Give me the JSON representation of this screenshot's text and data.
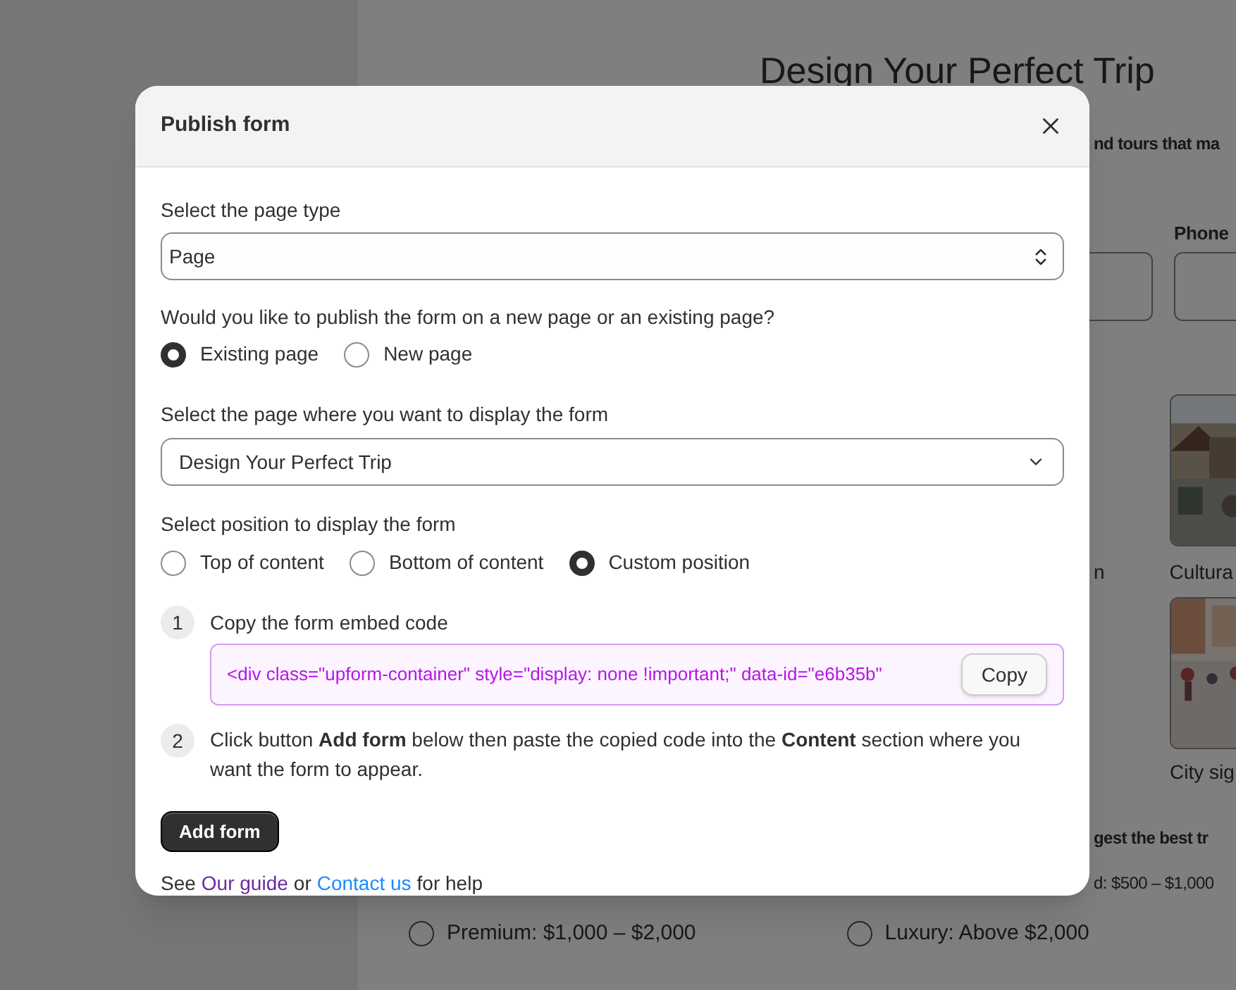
{
  "background_page": {
    "title": "Design Your Perfect Trip",
    "subtitle_fragment": "nd tours that ma",
    "phone_label": "Phone",
    "captions": [
      "n",
      "Cultura"
    ],
    "caption_2": "City sig",
    "question_fragment": "gest the best tr",
    "option_fragment": "d: $500 – $1,000",
    "budget_options": [
      {
        "label": "Premium: $1,000 – $2,000",
        "selected": false
      },
      {
        "label": "Luxury: Above $2,000",
        "selected": false
      }
    ]
  },
  "dialog": {
    "title": "Publish form",
    "page_type": {
      "label": "Select the page type",
      "value": "Page"
    },
    "publish_question": "Would you like to publish the form on a new page or an existing page?",
    "publish_options": [
      {
        "label": "Existing page",
        "selected": true
      },
      {
        "label": "New page",
        "selected": false
      }
    ],
    "target_page": {
      "label": "Select the page where you want to display the form",
      "value": "Design Your Perfect Trip"
    },
    "position_label": "Select position to display the form",
    "position_options": [
      {
        "label": "Top of content",
        "selected": false
      },
      {
        "label": "Bottom of content",
        "selected": false
      },
      {
        "label": "Custom position",
        "selected": true
      }
    ],
    "steps": [
      {
        "number": "1",
        "text": "Copy the form embed code"
      },
      {
        "number": "2",
        "text": "Click button **Add form** below then paste the copied code into the **Content** section where you want the form to appear."
      }
    ],
    "embed_code": "<div class=\"upform-container\" style=\"display: none !important;\" data-id=\"e6b35b\"",
    "copy_button": "Copy",
    "add_button": "Add form",
    "help": [
      {
        "kind": "text",
        "text": "See"
      },
      {
        "kind": "link",
        "text": "Our guide",
        "visited": true
      },
      {
        "kind": "text",
        "text": "or"
      },
      {
        "kind": "link",
        "text": "Contact us",
        "visited": false
      },
      {
        "kind": "text",
        "text": "for help"
      }
    ]
  }
}
